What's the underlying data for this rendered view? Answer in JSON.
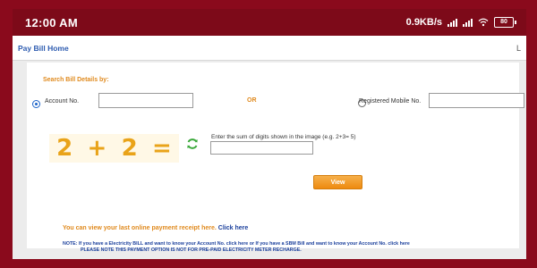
{
  "status_bar": {
    "time": "12:00 AM",
    "speed": "0.9KB/s",
    "battery": "80"
  },
  "header": {
    "title": "Pay Bill Home",
    "edge_char": "L"
  },
  "search": {
    "label": "Search Bill Details by:",
    "account_label": "Account No.",
    "or_label": "OR",
    "mobile_label": "Registered Mobile No.",
    "account_value": "",
    "mobile_value": ""
  },
  "captcha": {
    "digit1": "2",
    "plus": "+",
    "digit2": "2",
    "equals": "=",
    "hint": "Enter the sum of digits shown in the image (e.g. 2+3= 5)",
    "answer_value": ""
  },
  "actions": {
    "view_label": "View"
  },
  "receipt": {
    "text": "You can view your last online payment receipt here.",
    "link": "Click here"
  },
  "note": {
    "part1": "NOTE: If you have a Electricity BILL and want to know your Account No. click",
    "here1": "here",
    "part2": "or If you have a SBM Bill and want to know your Account No. click",
    "here2": "here",
    "line2": "PLEASE NOTE THIS PAYMENT OPTION IS NOT FOR PRE-PAID ELECTRICITY METER RECHARGE."
  },
  "colors": {
    "frame": "#8a0a1c",
    "status_bar": "#7d0a19",
    "accent_orange": "#e08a1e",
    "link_blue": "#1a3f9c"
  }
}
